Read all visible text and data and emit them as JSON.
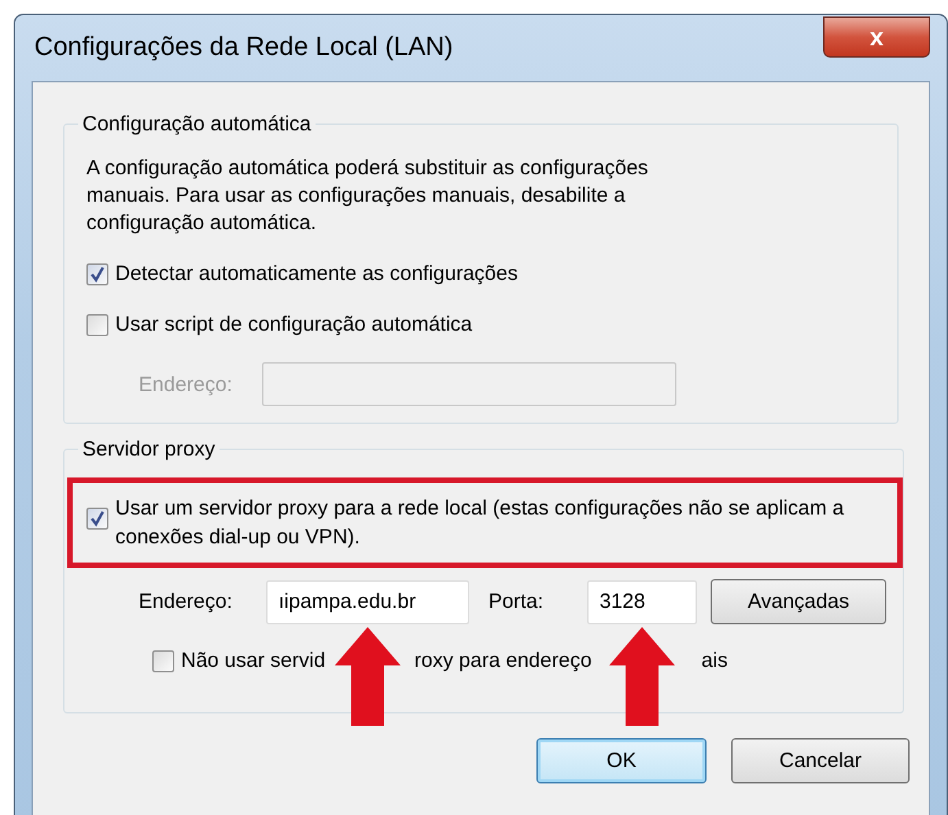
{
  "window": {
    "title": "Configurações da Rede Local (LAN)",
    "close_label": "x"
  },
  "auto_group": {
    "legend": "Configuração automática",
    "description": "A configuração automática poderá substituir as configurações manuais. Para usar as configurações manuais, desabilite a configuração automática.",
    "options": [
      {
        "label": "Detectar automaticamente as configurações",
        "checked": true
      },
      {
        "label": "Usar script de configuração automática",
        "checked": false
      }
    ],
    "address": {
      "label": "Endereço:",
      "disabled": true
    }
  },
  "proxy_group": {
    "legend": "Servidor proxy",
    "use_proxy": {
      "label": "Usar um servidor proxy para a rede local (estas configurações não se aplicam a conexões dial-up ou VPN).",
      "checked": true,
      "highlighted": true
    },
    "address": {
      "label": "Endereço:",
      "value": "ıipampa.edu.br"
    },
    "port": {
      "label": "Porta:",
      "value": "3128"
    },
    "advanced_button": "Avançadas",
    "bypass_local": {
      "label_parts": [
        "Não usar servid",
        "roxy para endereço",
        "ais"
      ],
      "checked": false
    }
  },
  "buttons": [
    {
      "label": "OK",
      "default": true
    },
    {
      "label": "Cancelar",
      "default": false
    }
  ]
}
